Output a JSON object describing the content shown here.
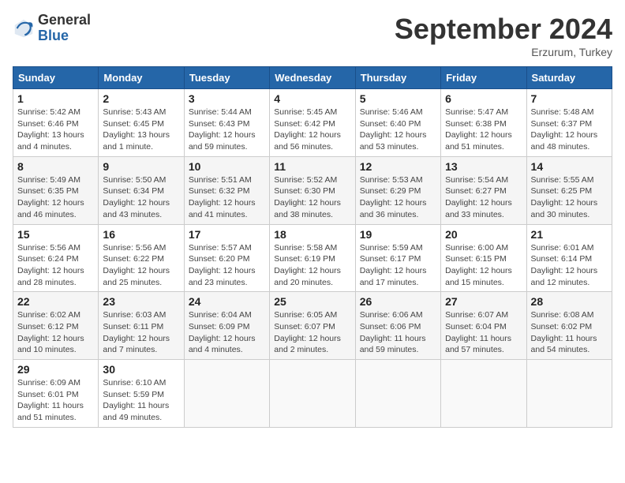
{
  "header": {
    "logo_general": "General",
    "logo_blue": "Blue",
    "title": "September 2024",
    "location": "Erzurum, Turkey"
  },
  "columns": [
    "Sunday",
    "Monday",
    "Tuesday",
    "Wednesday",
    "Thursday",
    "Friday",
    "Saturday"
  ],
  "weeks": [
    [
      {
        "day": "1",
        "detail": "Sunrise: 5:42 AM\nSunset: 6:46 PM\nDaylight: 13 hours\nand 4 minutes."
      },
      {
        "day": "2",
        "detail": "Sunrise: 5:43 AM\nSunset: 6:45 PM\nDaylight: 13 hours\nand 1 minute."
      },
      {
        "day": "3",
        "detail": "Sunrise: 5:44 AM\nSunset: 6:43 PM\nDaylight: 12 hours\nand 59 minutes."
      },
      {
        "day": "4",
        "detail": "Sunrise: 5:45 AM\nSunset: 6:42 PM\nDaylight: 12 hours\nand 56 minutes."
      },
      {
        "day": "5",
        "detail": "Sunrise: 5:46 AM\nSunset: 6:40 PM\nDaylight: 12 hours\nand 53 minutes."
      },
      {
        "day": "6",
        "detail": "Sunrise: 5:47 AM\nSunset: 6:38 PM\nDaylight: 12 hours\nand 51 minutes."
      },
      {
        "day": "7",
        "detail": "Sunrise: 5:48 AM\nSunset: 6:37 PM\nDaylight: 12 hours\nand 48 minutes."
      }
    ],
    [
      {
        "day": "8",
        "detail": "Sunrise: 5:49 AM\nSunset: 6:35 PM\nDaylight: 12 hours\nand 46 minutes."
      },
      {
        "day": "9",
        "detail": "Sunrise: 5:50 AM\nSunset: 6:34 PM\nDaylight: 12 hours\nand 43 minutes."
      },
      {
        "day": "10",
        "detail": "Sunrise: 5:51 AM\nSunset: 6:32 PM\nDaylight: 12 hours\nand 41 minutes."
      },
      {
        "day": "11",
        "detail": "Sunrise: 5:52 AM\nSunset: 6:30 PM\nDaylight: 12 hours\nand 38 minutes."
      },
      {
        "day": "12",
        "detail": "Sunrise: 5:53 AM\nSunset: 6:29 PM\nDaylight: 12 hours\nand 36 minutes."
      },
      {
        "day": "13",
        "detail": "Sunrise: 5:54 AM\nSunset: 6:27 PM\nDaylight: 12 hours\nand 33 minutes."
      },
      {
        "day": "14",
        "detail": "Sunrise: 5:55 AM\nSunset: 6:25 PM\nDaylight: 12 hours\nand 30 minutes."
      }
    ],
    [
      {
        "day": "15",
        "detail": "Sunrise: 5:56 AM\nSunset: 6:24 PM\nDaylight: 12 hours\nand 28 minutes."
      },
      {
        "day": "16",
        "detail": "Sunrise: 5:56 AM\nSunset: 6:22 PM\nDaylight: 12 hours\nand 25 minutes."
      },
      {
        "day": "17",
        "detail": "Sunrise: 5:57 AM\nSunset: 6:20 PM\nDaylight: 12 hours\nand 23 minutes."
      },
      {
        "day": "18",
        "detail": "Sunrise: 5:58 AM\nSunset: 6:19 PM\nDaylight: 12 hours\nand 20 minutes."
      },
      {
        "day": "19",
        "detail": "Sunrise: 5:59 AM\nSunset: 6:17 PM\nDaylight: 12 hours\nand 17 minutes."
      },
      {
        "day": "20",
        "detail": "Sunrise: 6:00 AM\nSunset: 6:15 PM\nDaylight: 12 hours\nand 15 minutes."
      },
      {
        "day": "21",
        "detail": "Sunrise: 6:01 AM\nSunset: 6:14 PM\nDaylight: 12 hours\nand 12 minutes."
      }
    ],
    [
      {
        "day": "22",
        "detail": "Sunrise: 6:02 AM\nSunset: 6:12 PM\nDaylight: 12 hours\nand 10 minutes."
      },
      {
        "day": "23",
        "detail": "Sunrise: 6:03 AM\nSunset: 6:11 PM\nDaylight: 12 hours\nand 7 minutes."
      },
      {
        "day": "24",
        "detail": "Sunrise: 6:04 AM\nSunset: 6:09 PM\nDaylight: 12 hours\nand 4 minutes."
      },
      {
        "day": "25",
        "detail": "Sunrise: 6:05 AM\nSunset: 6:07 PM\nDaylight: 12 hours\nand 2 minutes."
      },
      {
        "day": "26",
        "detail": "Sunrise: 6:06 AM\nSunset: 6:06 PM\nDaylight: 11 hours\nand 59 minutes."
      },
      {
        "day": "27",
        "detail": "Sunrise: 6:07 AM\nSunset: 6:04 PM\nDaylight: 11 hours\nand 57 minutes."
      },
      {
        "day": "28",
        "detail": "Sunrise: 6:08 AM\nSunset: 6:02 PM\nDaylight: 11 hours\nand 54 minutes."
      }
    ],
    [
      {
        "day": "29",
        "detail": "Sunrise: 6:09 AM\nSunset: 6:01 PM\nDaylight: 11 hours\nand 51 minutes."
      },
      {
        "day": "30",
        "detail": "Sunrise: 6:10 AM\nSunset: 5:59 PM\nDaylight: 11 hours\nand 49 minutes."
      },
      {
        "day": "",
        "detail": ""
      },
      {
        "day": "",
        "detail": ""
      },
      {
        "day": "",
        "detail": ""
      },
      {
        "day": "",
        "detail": ""
      },
      {
        "day": "",
        "detail": ""
      }
    ]
  ]
}
